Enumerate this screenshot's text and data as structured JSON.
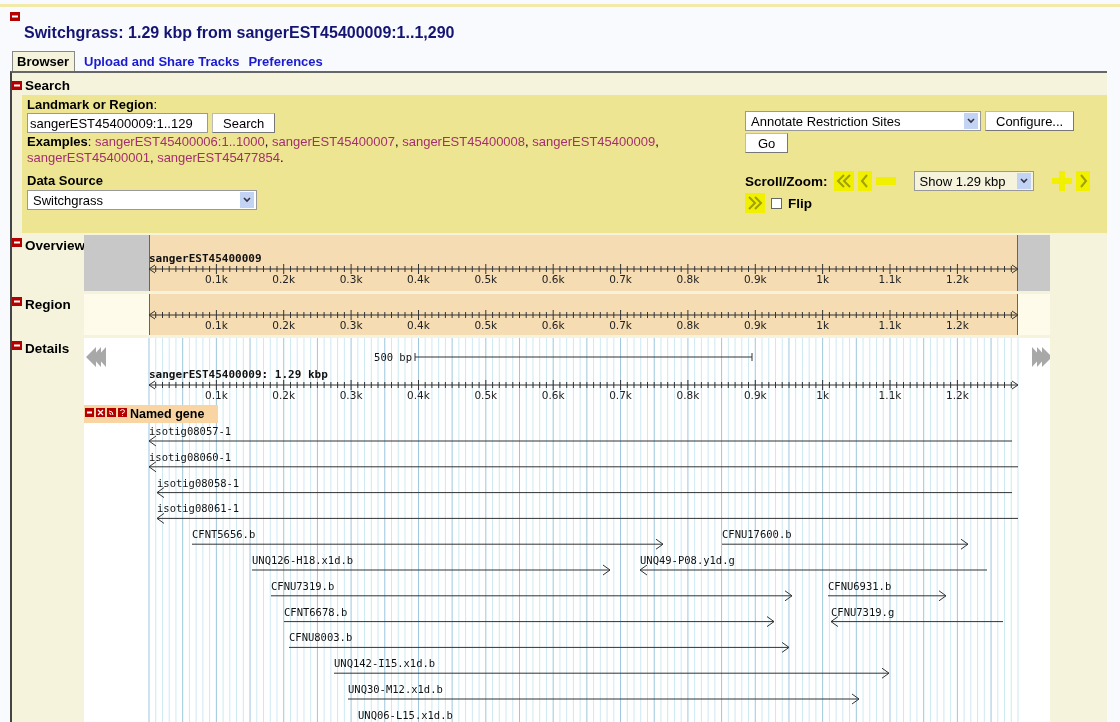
{
  "title": "Switchgrass: 1.29 kbp from sangerEST45400009:1..1,290",
  "title_expanded": true,
  "tabs": [
    {
      "label": "Browser",
      "selected": true
    },
    {
      "label": "Upload and Share Tracks",
      "selected": false
    },
    {
      "label": "Preferences",
      "selected": false
    }
  ],
  "search": {
    "heading": "Search",
    "expanded": true,
    "landmark_label": "**Landmark or Region**:",
    "landmark_value": "sangerEST45400009:1..129",
    "search_button": "Search",
    "examples_label": "**Examples**:",
    "examples": [
      {
        "link": "sangerEST45400006:1..1000",
        "after": ","
      },
      {
        "link": "sangerEST45400007",
        "after": ","
      },
      {
        "link": "sangerEST45400008",
        "after": ","
      },
      {
        "link": "sangerEST45400009",
        "after": ","
      },
      {
        "link": "sangerEST45400001",
        "after": ","
      },
      {
        "link": "sangerEST45477854",
        "after": "."
      }
    ],
    "data_source_label": "Data Source",
    "data_source_value": "Switchgrass",
    "plugin_value": "Annotate Restriction Sites",
    "configure_button": "Configure...",
    "go_button": "Go",
    "scroll_label": "Scroll/Zoom:",
    "zoom_value": "Show 1.29 kbp",
    "flip_label": "Flip",
    "flip_checked": false
  },
  "overview": {
    "heading": "Overview",
    "expanded": true,
    "landmark": "sangerEST45400009",
    "ticks": [
      "0.1k",
      "0.2k",
      "0.3k",
      "0.4k",
      "0.5k",
      "0.6k",
      "0.7k",
      "0.8k",
      "0.9k",
      "1k",
      "1.1k",
      "1.2k"
    ]
  },
  "region": {
    "heading": "Region",
    "expanded": true,
    "ticks": [
      "0.1k",
      "0.2k",
      "0.3k",
      "0.4k",
      "0.5k",
      "0.6k",
      "0.7k",
      "0.8k",
      "0.9k",
      "1k",
      "1.1k",
      "1.2k"
    ]
  },
  "details": {
    "heading": "Details",
    "expanded": true,
    "scale_label": "500 bp",
    "segment_label": "sangerEST45400009: 1.29 kbp",
    "ticks": [
      "0.1k",
      "0.2k",
      "0.3k",
      "0.4k",
      "0.5k",
      "0.6k",
      "0.7k",
      "0.8k",
      "0.9k",
      "1k",
      "1.1k",
      "1.2k"
    ],
    "track_title": "Named gene",
    "features": [
      {
        "name": "isotig08057-1",
        "reverse": true
      },
      {
        "name": "isotig08060-1",
        "reverse": true
      },
      {
        "name": "isotig08058-1",
        "reverse": true
      },
      {
        "name": "isotig08061-1",
        "reverse": true
      },
      {
        "name": "CFNT5656.b",
        "reverse": false
      },
      {
        "name": "CFNU17600.b",
        "reverse": false
      },
      {
        "name": "UNQ126-H18.x1d.b",
        "reverse": false
      },
      {
        "name": "UNQ49-P08.y1d.g",
        "reverse": true
      },
      {
        "name": "CFNU7319.b",
        "reverse": false
      },
      {
        "name": "CFNU6931.b",
        "reverse": false
      },
      {
        "name": "CFNT6678.b",
        "reverse": false
      },
      {
        "name": "CFNU7319.g",
        "reverse": true
      },
      {
        "name": "CFNU8003.b",
        "reverse": false
      },
      {
        "name": "UNQ142-I15.x1d.b",
        "reverse": false
      },
      {
        "name": "UNQ30-M12.x1d.b",
        "reverse": false
      },
      {
        "name": "UNQ06-L15.x1d.b"
      }
    ]
  }
}
